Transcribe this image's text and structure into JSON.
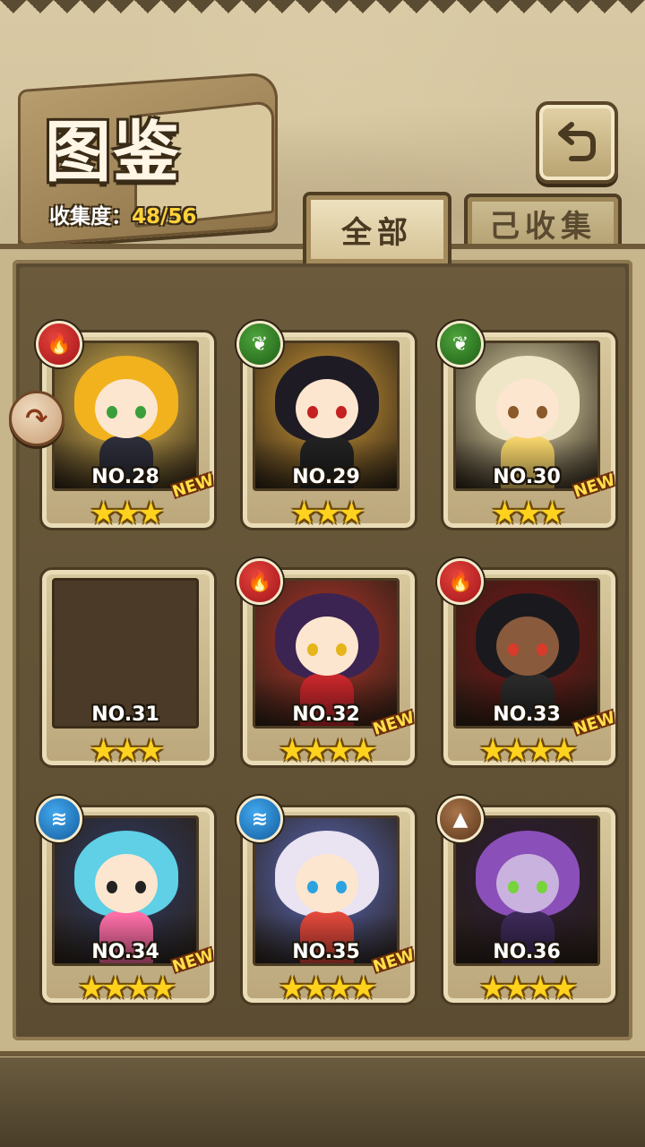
{
  "header": {
    "title": "图鉴",
    "collection_label": "收集度：",
    "collection_value": "48/56"
  },
  "tabs": [
    {
      "label": "全部",
      "selected": true
    },
    {
      "label": "己收集",
      "selected": false
    }
  ],
  "icons": {
    "back": "return-arrow-icon",
    "side": "curved-arrow-icon"
  },
  "cards": [
    {
      "no": "NO.28",
      "element": "fire",
      "stars": 3,
      "new": true,
      "hair": "#f2b21e",
      "skin": "#fde6cf",
      "bg": "#e9c45a",
      "outfit": "#2d2d3a",
      "eye": "#3a9f3a"
    },
    {
      "no": "NO.29",
      "element": "leaf",
      "stars": 3,
      "new": false,
      "hair": "#1e1b24",
      "skin": "#fde6cf",
      "bg": "#d9a13a",
      "outfit": "#222",
      "eye": "#c62121"
    },
    {
      "no": "NO.30",
      "element": "leaf",
      "stars": 3,
      "new": true,
      "hair": "#efe6c8",
      "skin": "#fde6cf",
      "bg": "#f0e7b8",
      "outfit": "#f5d36a",
      "eye": "#8b5a2b"
    },
    {
      "no": "NO.31",
      "element": "none",
      "stars": 3,
      "new": false,
      "silhouette": true
    },
    {
      "no": "NO.32",
      "element": "fire",
      "stars": 4,
      "new": true,
      "hair": "#3b2451",
      "skin": "#fde6cf",
      "bg": "#b9342c",
      "outfit": "#c8272c",
      "eye": "#e5b51a"
    },
    {
      "no": "NO.33",
      "element": "fire",
      "stars": 4,
      "new": true,
      "hair": "#1a1a1e",
      "skin": "#8a5a3c",
      "bg": "#7a1418",
      "outfit": "#2a2a2a",
      "eye": "#d93b2b"
    },
    {
      "no": "NO.34",
      "element": "water",
      "stars": 4,
      "new": true,
      "hair": "#5fd0e6",
      "skin": "#fde6cf",
      "bg": "#2f3d6a",
      "outfit": "#ff6fa8",
      "eye": "#222"
    },
    {
      "no": "NO.35",
      "element": "water",
      "stars": 4,
      "new": true,
      "hair": "#e9e3f2",
      "skin": "#fde6cf",
      "bg": "#5a6cc2",
      "outfit": "#e2483b",
      "eye": "#2aa3e0"
    },
    {
      "no": "NO.36",
      "element": "earth",
      "stars": 4,
      "new": false,
      "hair": "#8a4fb8",
      "skin": "#c9b2de",
      "bg": "#2b1b3b",
      "outfit": "#3e2a5a",
      "eye": "#77d43a"
    }
  ]
}
